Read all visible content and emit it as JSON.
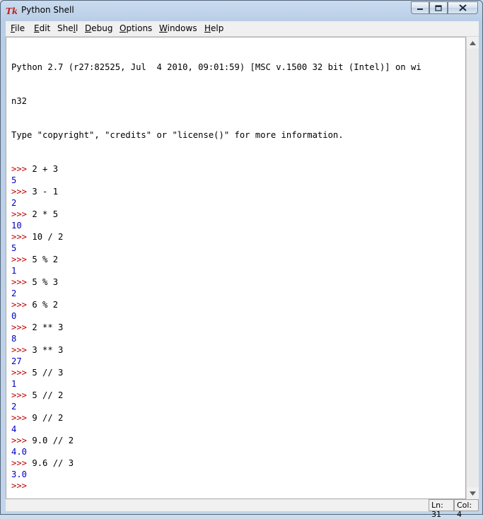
{
  "window": {
    "title": "Python Shell"
  },
  "menu": [
    "File",
    "Edit",
    "Shell",
    "Debug",
    "Options",
    "Windows",
    "Help"
  ],
  "menu_underline": [
    "F",
    "E",
    "l",
    "D",
    "O",
    "W",
    "H"
  ],
  "shell": {
    "banner": [
      "Python 2.7 (r27:82525, Jul  4 2010, 09:01:59) [MSC v.1500 32 bit (Intel)] on wi",
      "n32",
      "Type \"copyright\", \"credits\" or \"license()\" for more information."
    ],
    "prompt": ">>>",
    "entries": [
      {
        "input": "2 + 3",
        "output": "5"
      },
      {
        "input": "3 - 1",
        "output": "2"
      },
      {
        "input": "2 * 5",
        "output": "10"
      },
      {
        "input": "10 / 2",
        "output": "5"
      },
      {
        "input": "5 % 2",
        "output": "1"
      },
      {
        "input": "5 % 3",
        "output": "2"
      },
      {
        "input": "6 % 2",
        "output": "0"
      },
      {
        "input": "2 ** 3",
        "output": "8"
      },
      {
        "input": "3 ** 3",
        "output": "27"
      },
      {
        "input": "5 // 3",
        "output": "1"
      },
      {
        "input": "5 // 2",
        "output": "2"
      },
      {
        "input": "9 // 2",
        "output": "4"
      },
      {
        "input": "9.0 // 2",
        "output": "4.0"
      },
      {
        "input": "9.6 // 3",
        "output": "3.0"
      }
    ]
  },
  "status": {
    "line": "Ln: 31",
    "col": "Col: 4"
  },
  "icons": {
    "app": "tk-feather-icon",
    "minimize": "minimize-icon",
    "maximize": "maximize-icon",
    "close": "close-icon"
  }
}
